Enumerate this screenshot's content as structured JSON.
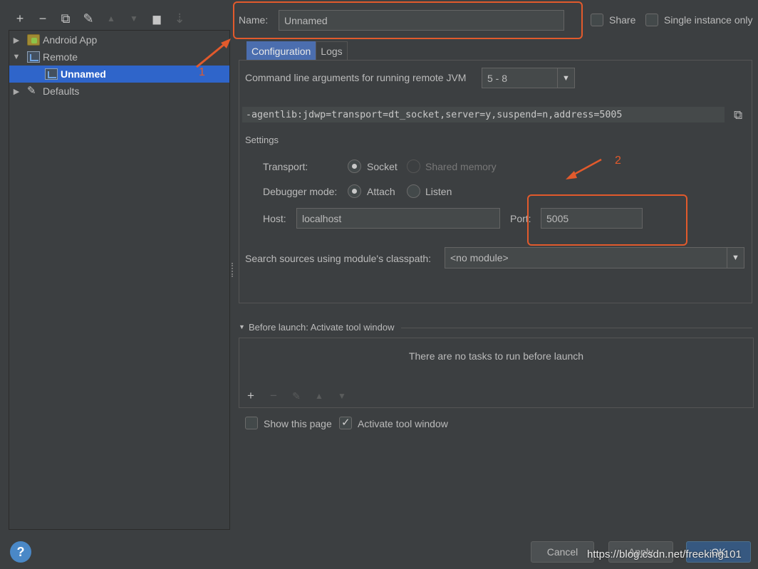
{
  "toolbar": {
    "buttons": [
      {
        "icon": "plus-icon",
        "glyph": "+"
      },
      {
        "icon": "minus-icon",
        "glyph": "−"
      },
      {
        "icon": "copy-icon",
        "glyph": "⧉"
      },
      {
        "icon": "wrench-icon",
        "glyph": "✎"
      },
      {
        "icon": "arrow-up-icon",
        "glyph": "▲"
      },
      {
        "icon": "arrow-down-icon",
        "glyph": "▼"
      },
      {
        "icon": "folder-icon",
        "glyph": "▆"
      },
      {
        "icon": "sort-icon",
        "glyph": "⇣"
      }
    ]
  },
  "tree": {
    "items": [
      {
        "label": "Android App",
        "icon": "android-app-icon",
        "expanded": false
      },
      {
        "label": "Remote",
        "icon": "remote-icon",
        "expanded": true
      },
      {
        "label": "Unnamed",
        "icon": "remote-config-icon",
        "selected": true
      },
      {
        "label": "Defaults",
        "icon": "wrench-icon",
        "expanded": false
      }
    ]
  },
  "header": {
    "name_label": "Name:",
    "name_value": "Unnamed",
    "share_label": "Share",
    "single_instance_label": "Single instance only"
  },
  "tabs": [
    {
      "label": "Configuration",
      "active": true
    },
    {
      "label": "Logs",
      "active": false
    }
  ],
  "config": {
    "cmd_label": "Command line arguments for running remote JVM",
    "jvm_version": "5 - 8",
    "cmd_value": "-agentlib:jdwp=transport=dt_socket,server=y,suspend=n,address=5005",
    "settings_label": "Settings",
    "transport_label": "Transport:",
    "transport_socket": "Socket",
    "transport_shared": "Shared memory",
    "debugger_mode_label": "Debugger mode:",
    "mode_attach": "Attach",
    "mode_listen": "Listen",
    "host_label": "Host:",
    "host_value": "localhost",
    "port_label": "Port:",
    "port_value": "5005",
    "search_label": "Search sources using module's classpath:",
    "module_value": "<no module>"
  },
  "before_launch": {
    "title": "Before launch: Activate tool window",
    "empty_text": "There are no tasks to run before launch",
    "show_page_label": "Show this page",
    "activate_label": "Activate tool window",
    "show_page_checked": false,
    "activate_checked": true
  },
  "footer": {
    "help": "?",
    "cancel": "Cancel",
    "apply": "Apply",
    "ok": "OK"
  },
  "annotations": {
    "label1": "1",
    "label2": "2",
    "color": "#e25a2c",
    "watermark": "https://blog.csdn.net/freeking101"
  }
}
